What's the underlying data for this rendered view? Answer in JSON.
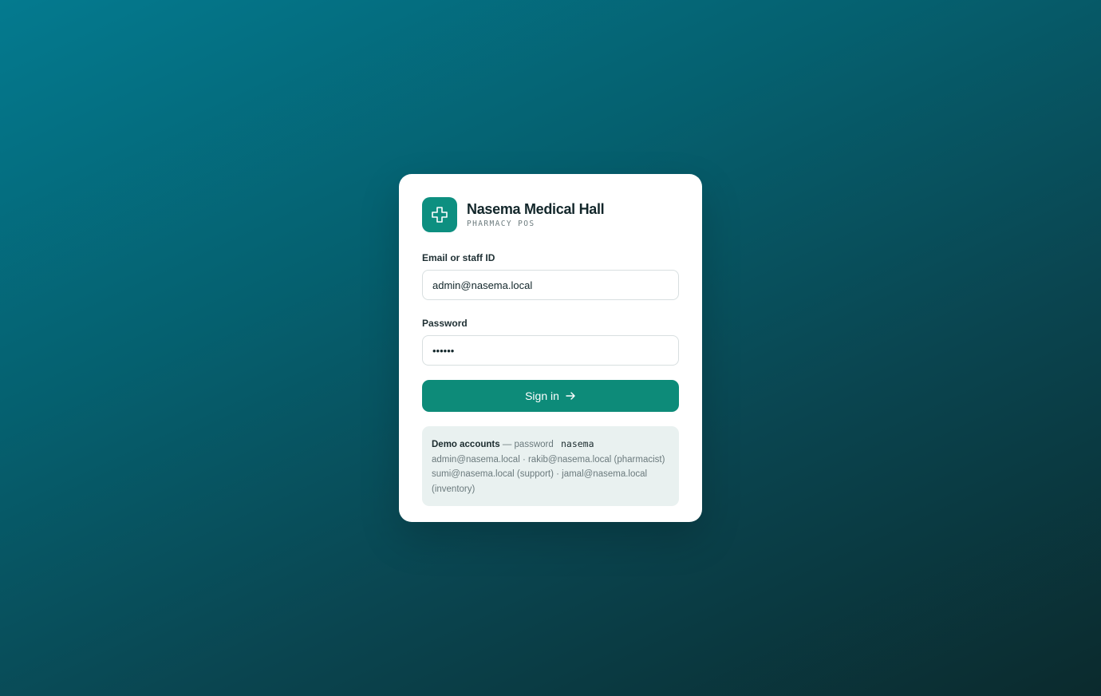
{
  "brand": {
    "name": "Nasema Medical Hall",
    "subtitle": "PHARMACY POS",
    "logo_icon": "medical-cross-icon",
    "accent_color": "#0d8f80"
  },
  "form": {
    "email_label": "Email or staff ID",
    "email_value": "admin@nasema.local",
    "password_label": "Password",
    "password_value": "••••••",
    "signin_label": "Sign in",
    "signin_icon": "arrow-right-icon"
  },
  "demo": {
    "title": "Demo accounts",
    "password_prefix": "— password",
    "password_code": "nasema",
    "line1": "admin@nasema.local · rakib@nasema.local (pharmacist)",
    "line2": "sumi@nasema.local (support) · jamal@nasema.local (inventory)"
  }
}
